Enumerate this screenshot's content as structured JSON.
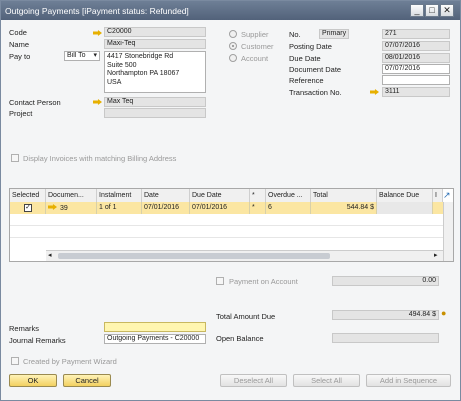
{
  "title": "Outgoing Payments [iPayment status: Refunded]",
  "left": {
    "code_label": "Code",
    "code_value": "C20000",
    "name_label": "Name",
    "name_value": "Maxi-Teq",
    "payto_label": "Pay to",
    "payto_select": "Bill To",
    "address_lines": [
      "4417 Stonebridge Rd",
      "Suite 500",
      "Northampton PA  18067",
      "USA"
    ],
    "contact_label": "Contact Person",
    "contact_value": "Max Teq",
    "project_label": "Project"
  },
  "radios": {
    "supplier": "Supplier",
    "customer": "Customer",
    "account": "Account"
  },
  "right": {
    "no_label": "No.",
    "series": "Primary",
    "no_value": "271",
    "posting_label": "Posting Date",
    "posting_value": "07/07/2016",
    "due_label": "Due Date",
    "due_value": "08/01/2016",
    "docdate_label": "Document Date",
    "docdate_value": "07/07/2016",
    "ref_label": "Reference",
    "trans_label": "Transaction No.",
    "trans_value": "3111"
  },
  "display_invoices": "Display Invoices with matching Billing Address",
  "table": {
    "headers": [
      "Selected",
      "Documen...",
      "Instalment",
      "Date",
      "Due Date",
      "*",
      "Overdue ...",
      "Total",
      "Balance Due",
      "I"
    ],
    "row": {
      "doc": "39",
      "instalment": "1 of 1",
      "date": "07/01/2016",
      "due": "07/01/2016",
      "star": "*",
      "overdue": "6",
      "total": "544.84 $"
    }
  },
  "payment_on_account_label": "Payment on Account",
  "payment_on_account_value": "0.00",
  "total_due_label": "Total Amount Due",
  "total_due_value": "494.84 $",
  "open_balance_label": "Open Balance",
  "remarks_label": "Remarks",
  "journal_label": "Journal Remarks",
  "journal_value": "Outgoing Payments - C20000",
  "wizard_label": "Created by Payment Wizard",
  "buttons": {
    "ok": "OK",
    "cancel": "Cancel",
    "deselect": "Deselect All",
    "select": "Select All",
    "sequence": "Add in Sequence"
  }
}
